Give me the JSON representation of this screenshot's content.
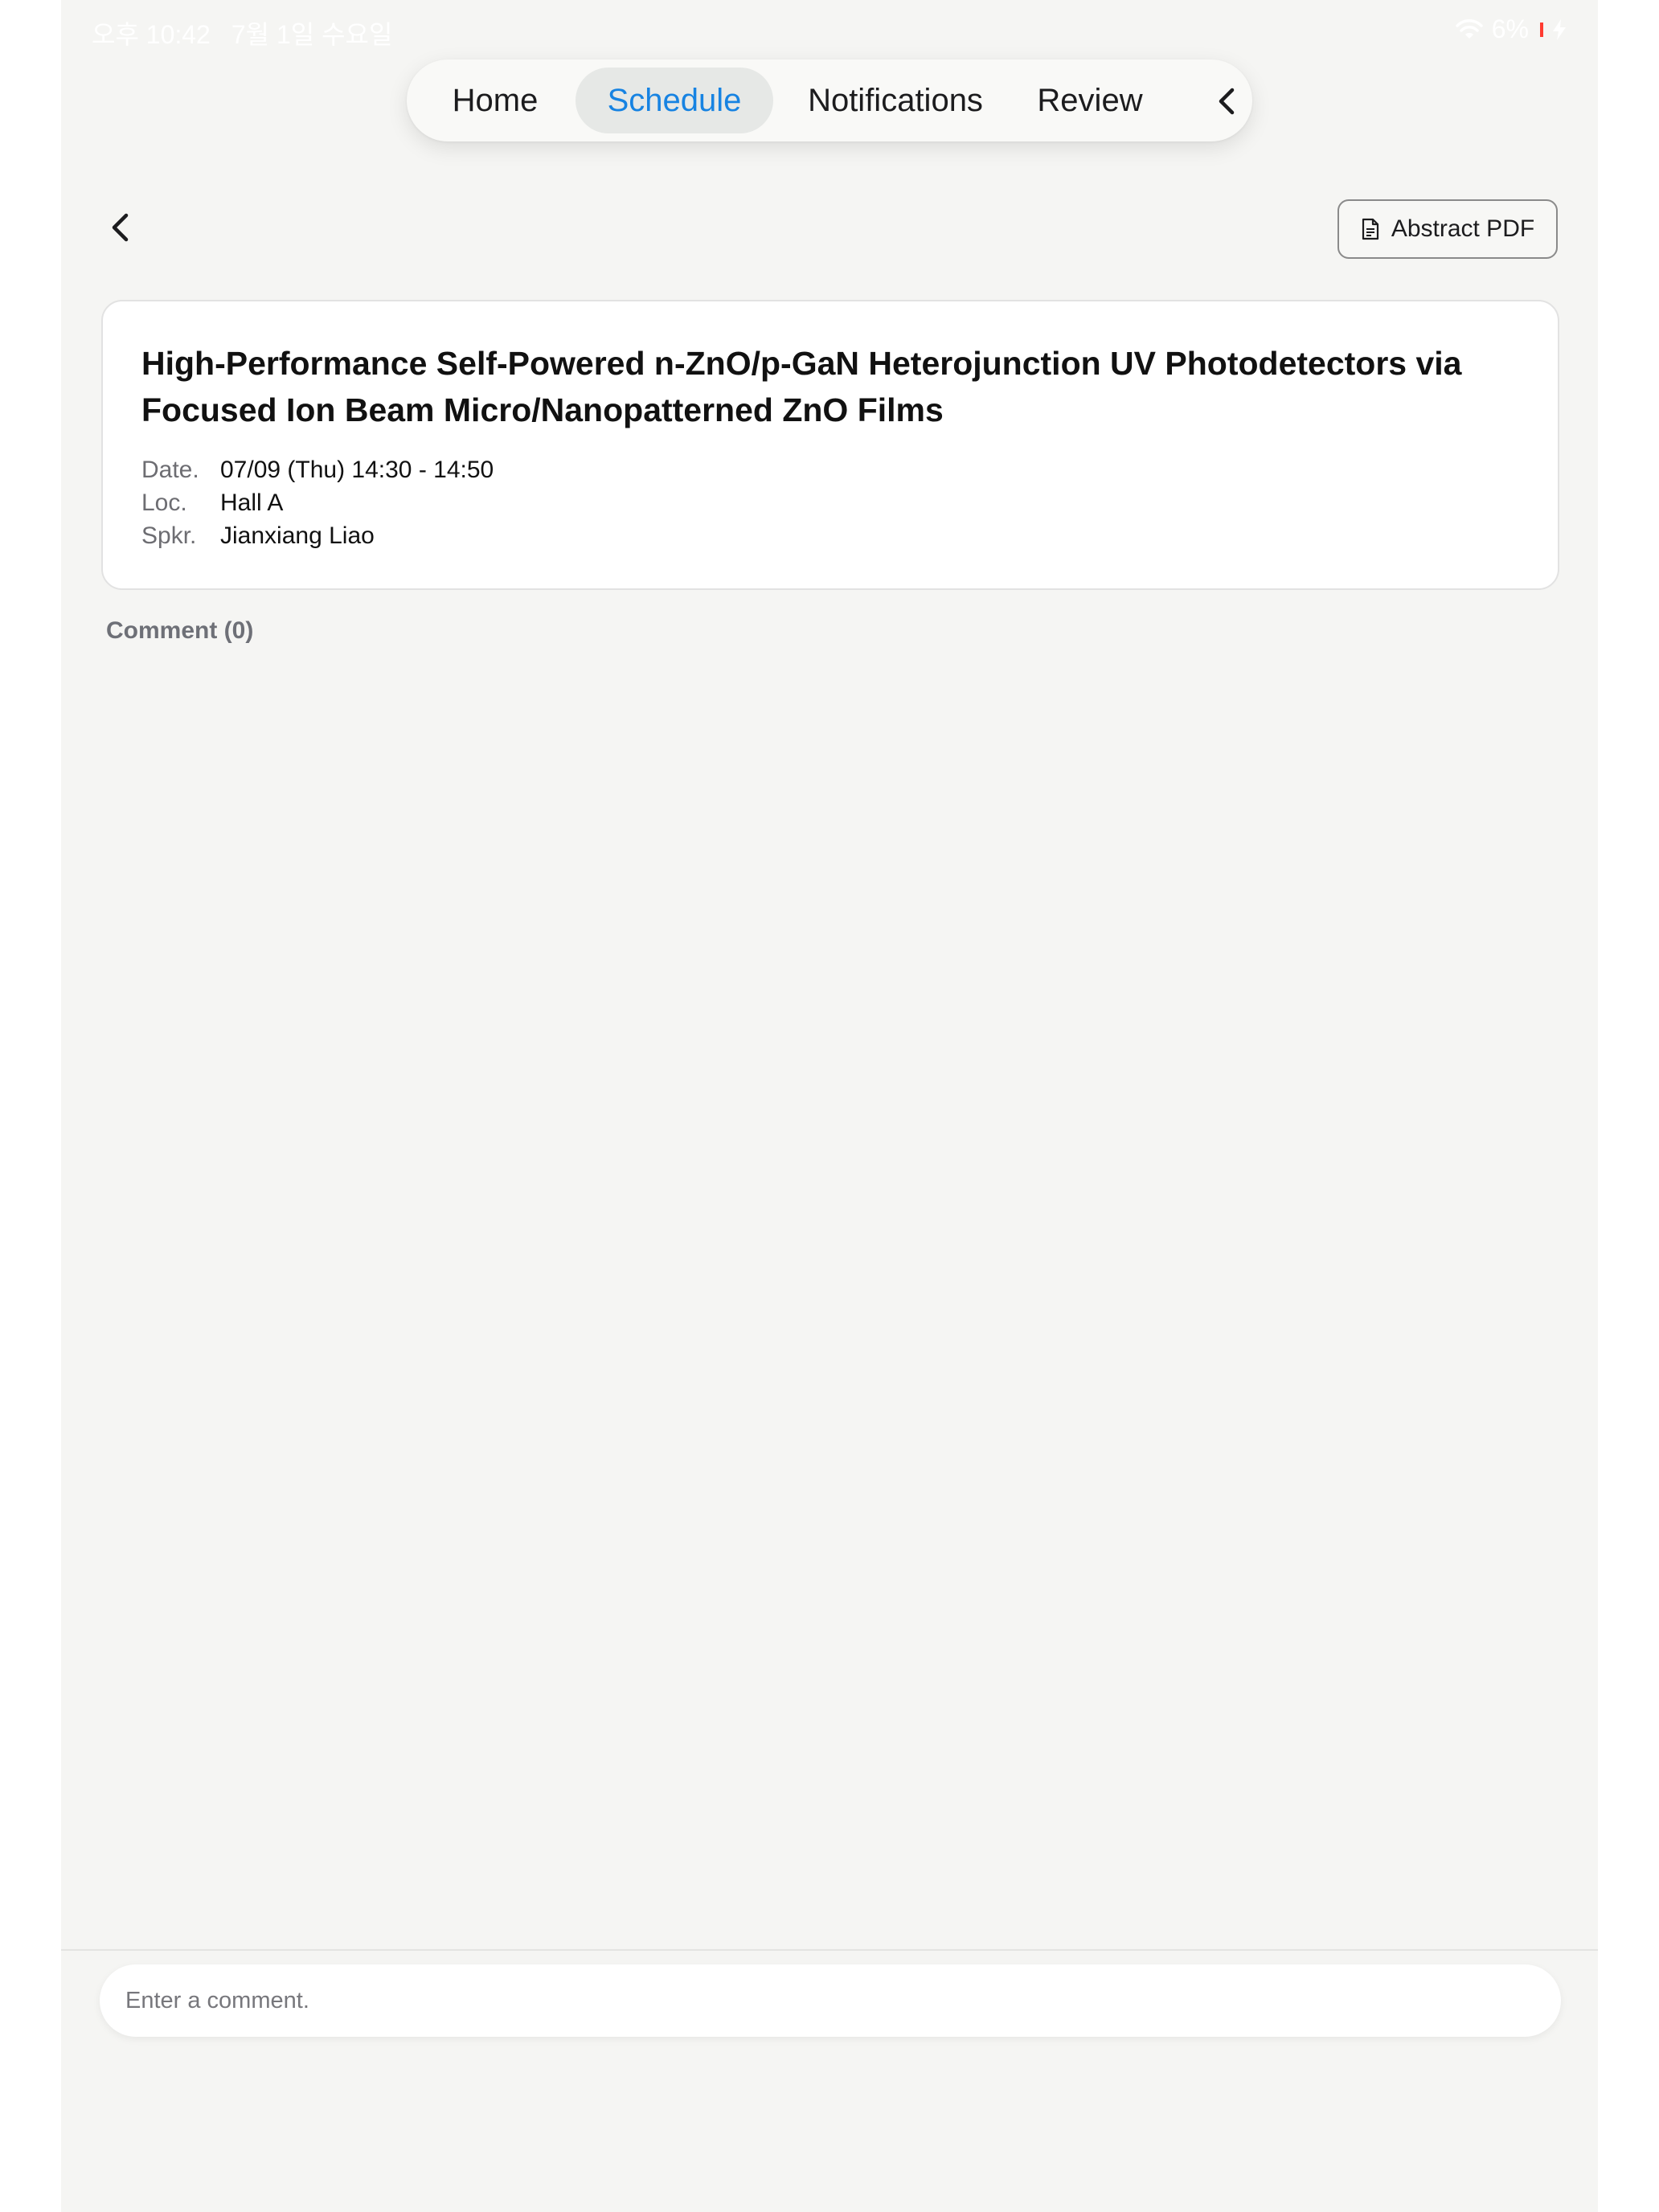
{
  "status_bar": {
    "time": "오후 10:42",
    "date": "7월 1일 수요일",
    "battery": "6%"
  },
  "nav": {
    "tabs": [
      {
        "label": "Home",
        "active": false
      },
      {
        "label": "Schedule",
        "active": true
      },
      {
        "label": "Notifications",
        "active": false
      },
      {
        "label": "Review",
        "active": false
      }
    ],
    "collapse_icon": "chevron-left-icon"
  },
  "header": {
    "back_icon": "chevron-left-icon",
    "pdf_button_label": "Abstract PDF",
    "pdf_icon": "document-icon"
  },
  "session": {
    "title": "High-Performance Self-Powered n-ZnO/p-GaN Heterojunction UV Photodetectors via Focused Ion Beam Micro/Nanopatterned ZnO Films",
    "date_label": "Date.",
    "date_value": "07/09 (Thu) 14:30 - 14:50",
    "location_label": "Loc.",
    "location_value": "Hall A",
    "speaker_label": "Spkr.",
    "speaker_value": "Jianxiang Liao"
  },
  "comments": {
    "count_label": "Comment (0)",
    "input_placeholder": "Enter a comment."
  },
  "colors": {
    "accent": "#1783e2",
    "background": "#f5f5f3",
    "battery_low": "#ff3b30"
  }
}
